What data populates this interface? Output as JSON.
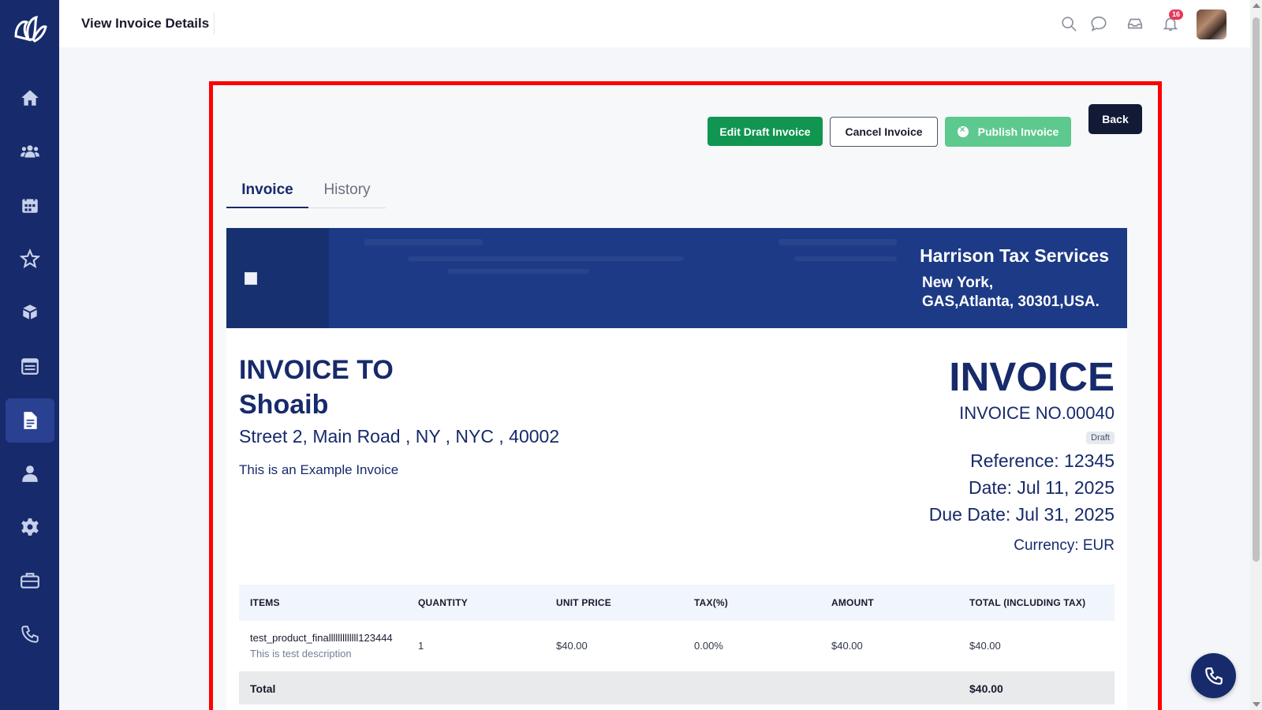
{
  "header": {
    "title": "View Invoice Details",
    "notification_count": "16"
  },
  "sidebar": {
    "items": [
      {
        "name": "home",
        "icon": "home-icon"
      },
      {
        "name": "clients",
        "icon": "users-icon"
      },
      {
        "name": "calendar",
        "icon": "calendar-icon"
      },
      {
        "name": "favorites",
        "icon": "star-icon"
      },
      {
        "name": "products",
        "icon": "box-icon"
      },
      {
        "name": "schedule",
        "icon": "calendar-list-icon"
      },
      {
        "name": "invoices",
        "icon": "document-icon",
        "active": true
      },
      {
        "name": "profile",
        "icon": "user-icon"
      },
      {
        "name": "settings",
        "icon": "gear-icon"
      },
      {
        "name": "briefcase",
        "icon": "briefcase-icon"
      },
      {
        "name": "calls",
        "icon": "phone-icon"
      }
    ]
  },
  "actions": {
    "edit_draft": "Edit Draft Invoice",
    "cancel": "Cancel Invoice",
    "publish": "Publish Invoice",
    "back": "Back"
  },
  "tabs": {
    "invoice": "Invoice",
    "history": "History"
  },
  "company": {
    "name": "Harrison Tax Services",
    "address_line1": "New York,",
    "address_line2": "GAS,Atlanta, 30301,USA."
  },
  "invoice": {
    "to_label": "INVOICE TO",
    "client_name": "Shoaib",
    "client_address": "Street 2, Main Road , NY , NYC , 40002",
    "description": "This is an Example Invoice",
    "title": "INVOICE",
    "number": "INVOICE NO.00040",
    "status": "Draft",
    "reference": "Reference: 12345",
    "date": "Date: Jul 11, 2025",
    "due_date": "Due Date: Jul 31, 2025",
    "currency": "Currency: EUR"
  },
  "table": {
    "columns": [
      "ITEMS",
      "QUANTITY",
      "UNIT PRICE",
      "TAX(%)",
      "AMOUNT",
      "TOTAL (INCLUDING TAX)"
    ],
    "rows": [
      {
        "item": "test_product_finalllllllllllll123444",
        "item_desc": "This is test description",
        "quantity": "1",
        "unit_price": "$40.00",
        "tax": "0.00%",
        "amount": "$40.00",
        "total": "$40.00"
      }
    ],
    "total_label": "Total",
    "total_value": "$40.00"
  },
  "colors": {
    "sidebar": "#172a6b",
    "primary_green": "#109650",
    "publish_green": "#5dc98e",
    "highlight": "#ff0000"
  }
}
